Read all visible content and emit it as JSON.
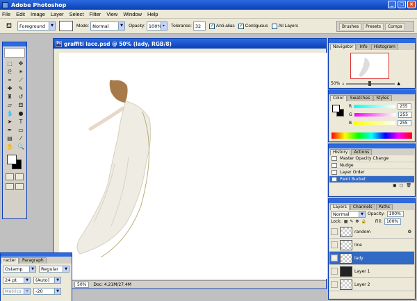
{
  "app": {
    "title": "Adobe Photoshop"
  },
  "menu": [
    "File",
    "Edit",
    "Image",
    "Layer",
    "Select",
    "Filter",
    "View",
    "Window",
    "Help"
  ],
  "options": {
    "fill_source": "Foreground",
    "mode_label": "Mode:",
    "mode_value": "Normal",
    "opacity_label": "Opacity:",
    "opacity_value": "100%",
    "tolerance_label": "Tolerance:",
    "tolerance_value": "32",
    "antialias_label": "Anti-alias",
    "contiguous_label": "Contiguous",
    "all_layers_label": "All Layers",
    "well_tabs": [
      "Brushes",
      "Presets",
      "Comps"
    ]
  },
  "document": {
    "title": "graffiti lace.psd @ 50% (lady, RGB/8)",
    "zoom": "50%",
    "doc_size": "Doc: 4.21M/27.4M"
  },
  "navigator": {
    "tabs": [
      "Navigator",
      "Info",
      "Histogram"
    ],
    "zoom": "50%"
  },
  "color_panel": {
    "tabs": [
      "Color",
      "Swatches",
      "Styles"
    ],
    "channels": [
      {
        "label": "R",
        "value": "255"
      },
      {
        "label": "G",
        "value": "255"
      },
      {
        "label": "B",
        "value": "255"
      }
    ]
  },
  "history": {
    "tabs": [
      "History",
      "Actions"
    ],
    "items": [
      "Master Opacity Change",
      "Nudge",
      "Layer Order",
      "Paint Bucket"
    ]
  },
  "layers": {
    "tabs": [
      "Layers",
      "Channels",
      "Paths"
    ],
    "blend": "Normal",
    "opacity_label": "Opacity:",
    "opacity_value": "100%",
    "lock_label": "Lock:",
    "fill_label": "Fill:",
    "fill_value": "100%",
    "items": [
      "random",
      "line",
      "lady",
      "Layer 1",
      "Layer 2"
    ]
  },
  "character": {
    "tabs": [
      "racter",
      "Paragraph"
    ],
    "font_family": "Ostamp",
    "font_style": "Regular",
    "font_size": "24 pt",
    "leading": "(Auto)",
    "kerning": "Metrics",
    "tracking": "-20"
  },
  "colors": {
    "title_bar": "#0a3fb5",
    "selection": "#316ac5"
  }
}
